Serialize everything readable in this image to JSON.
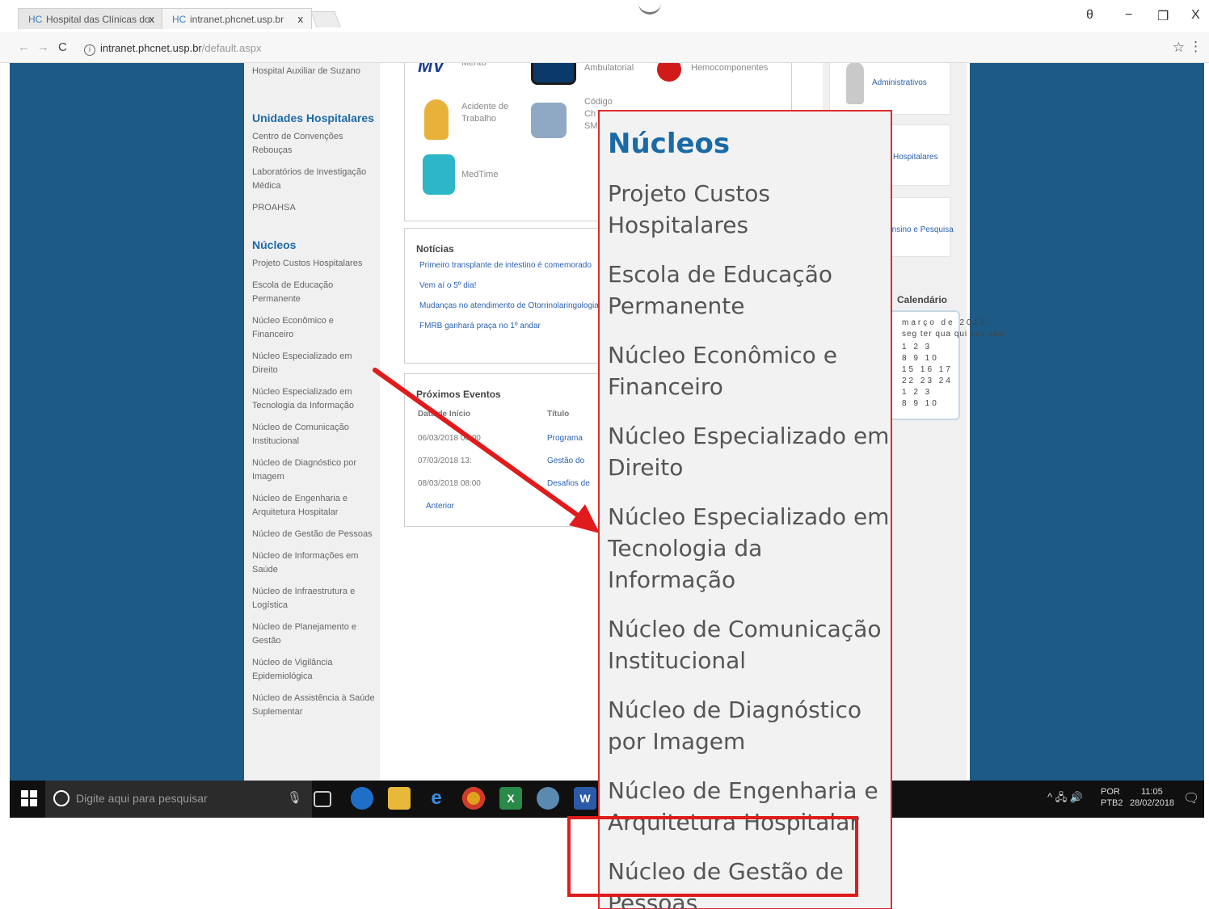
{
  "browser": {
    "tabs": [
      {
        "icon": "HC",
        "label": "Hospital das Clínicas do",
        "close": "x"
      },
      {
        "icon": "HC",
        "label": "intranet.phcnet.usp.br",
        "close": "x"
      }
    ],
    "window_controls": {
      "user": "θ",
      "minimize": "−",
      "maximize": "❐",
      "close": "X"
    },
    "nav": {
      "back": "←",
      "forward": "→",
      "reload": "C"
    },
    "url_host": "intranet.phcnet.usp.br",
    "url_path": "/default.aspx",
    "star": "☆",
    "menu": "⋮"
  },
  "sidebar": {
    "top_items": [
      "Hospital Auxiliar de Suzano"
    ],
    "unidades_title": "Unidades Hospitalares",
    "unidades_items": [
      "Centro de Convenções Rebouças",
      "Laboratórios de Investigação Médica",
      "PROAHSA"
    ],
    "nucleos_title": "Núcleos",
    "nucleos_items": [
      "Projeto Custos Hospitalares",
      "Escola de Educação Permanente",
      "Núcleo Econômico e Financeiro",
      "Núcleo Especializado em Direito",
      "Núcleo Especializado em Tecnologia da Informação",
      "Núcleo de Comunicação Institucional",
      "Núcleo de Diagnóstico por Imagem",
      "Núcleo de Engenharia e Arquitetura Hospitalar",
      "Núcleo de Gestão de Pessoas",
      "Núcleo de Informações em Saúde",
      "Núcleo de Infraestrutura e Logística",
      "Núcleo de Planejamento e Gestão",
      "Núcleo de Vigilância Epidemiológica",
      "Núcleo de Assistência à Saúde Suplementar"
    ]
  },
  "tiles": {
    "mv": "MV",
    "mv_label": "Mérito",
    "ambulatorial": "Ambulatorial",
    "hemocomponentes": "Hemocomponentes",
    "acidente": "Acidente de Trabalho",
    "codigo": "Código Ch SM",
    "medtime": "MedTime"
  },
  "news": {
    "title": "Notícias",
    "items": [
      "Primeiro transplante de intestino é comemorado",
      "Vem aí o 5º dia!",
      "Mudanças no atendimento de Otorrinolaringologia",
      "FMRB ganhará praça no 1º andar"
    ]
  },
  "events": {
    "title": "Próximos Eventos",
    "col_date": "Data de Início",
    "col_title": "Título",
    "rows": [
      {
        "date": "06/03/2018 00:00",
        "title": "Programa"
      },
      {
        "date": "07/03/2018 13:",
        "title": "Gestão do"
      },
      {
        "date": "08/03/2018 08:00",
        "title": "Desafios de"
      }
    ],
    "previous": "Anterior"
  },
  "right": {
    "admin": "Administrativos",
    "hospitalares": "Hospitalares",
    "ensino": "Ensino e Pesquisa",
    "calendar_title": "Calendário",
    "calendar_month": "março de 2018",
    "calendar_header": "seg ter qua qui sex sáb",
    "calendar_rows": [
      "1 2 3",
      "8 9 10",
      "15 16 17",
      "22 23 24",
      "1 2 3",
      "8 9 10"
    ]
  },
  "taskbar": {
    "search_placeholder": "Digite aqui para pesquisar",
    "lang_top": "POR",
    "lang_bottom": "PTB2",
    "time": "11:05",
    "date": "28/02/2018",
    "tray_icons": "^ 🖧 🔊"
  },
  "zoom": {
    "title": "Núcleos",
    "items": [
      "Projeto Custos Hospitalares",
      "Escola de Educação Permanente",
      "Núcleo Econômico e Financeiro",
      "Núcleo Especializado em Direito",
      "Núcleo Especializado em Tecnologia da Informação",
      "Núcleo de Comunicação Institucional",
      "Núcleo de Diagnóstico por Imagem",
      "Núcleo de Engenharia e Arquitetura Hospitalar",
      "Núcleo de Gestão de Pessoas"
    ],
    "highlight_color": "#e01b1b",
    "arrow_color": "#e01b1b",
    "title_color": "#1a6aa6"
  }
}
